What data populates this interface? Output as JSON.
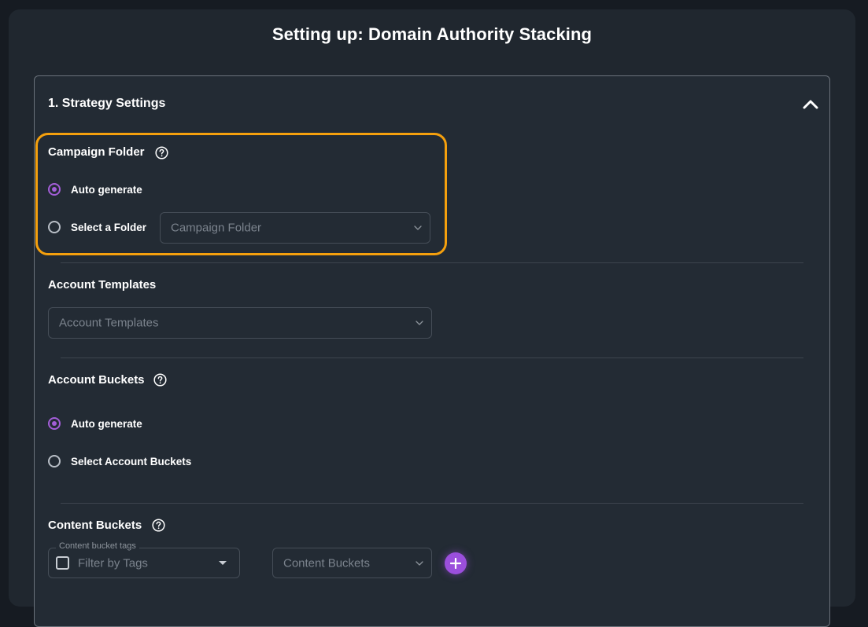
{
  "page": {
    "title": "Setting up: Domain Authority Stacking"
  },
  "strategy": {
    "title": "1. Strategy Settings",
    "campaign_folder": {
      "label": "Campaign Folder",
      "options": [
        "Auto generate",
        "Select a Folder"
      ],
      "selected": "Auto generate",
      "select_placeholder": "Campaign Folder"
    },
    "account_templates": {
      "label": "Account Templates",
      "select_placeholder": "Account Templates"
    },
    "account_buckets": {
      "label": "Account Buckets",
      "options": [
        "Auto generate",
        "Select Account Buckets"
      ],
      "selected": "Auto generate"
    },
    "content_buckets": {
      "label": "Content Buckets",
      "tags_legend": "Content bucket tags",
      "tags_placeholder": "Filter by Tags",
      "select_placeholder": "Content Buckets"
    }
  },
  "colors": {
    "highlight": "#f5a00d",
    "accent": "#9b4fdc",
    "background": "#20272f"
  },
  "icons": {
    "help": "question-circle-icon",
    "collapse": "chevron-up-icon",
    "add": "plus-icon"
  }
}
